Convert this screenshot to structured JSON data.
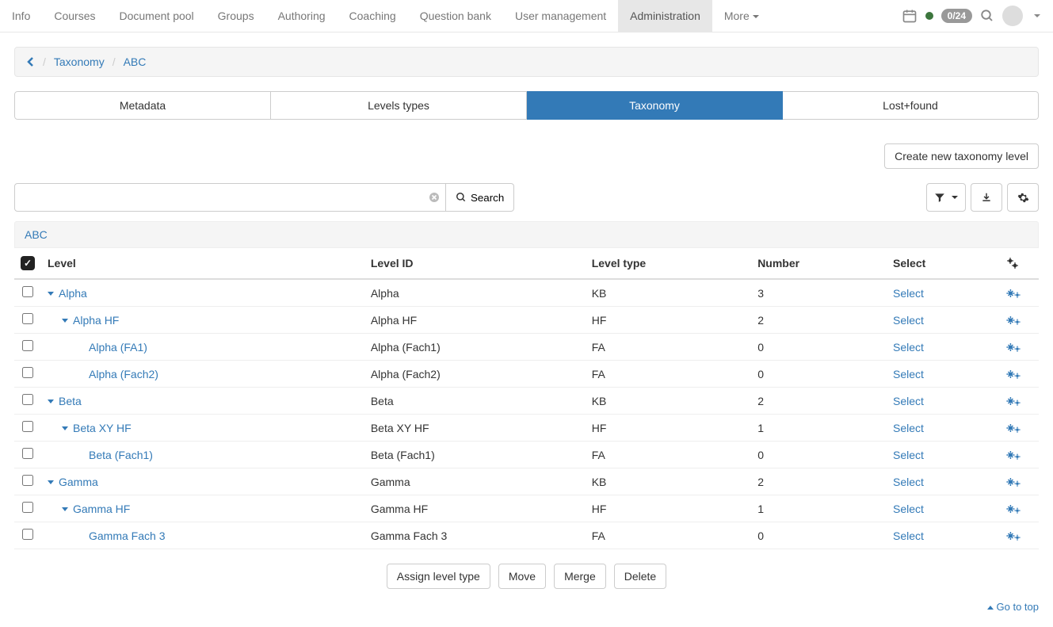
{
  "topnav": {
    "items": [
      "Info",
      "Courses",
      "Document pool",
      "Groups",
      "Authoring",
      "Coaching",
      "Question bank",
      "User management",
      "Administration",
      "More"
    ],
    "active_index": 8,
    "badge": "0/24"
  },
  "breadcrumb": {
    "items": [
      "Taxonomy",
      "ABC"
    ]
  },
  "tabs": {
    "items": [
      "Metadata",
      "Levels types",
      "Taxonomy",
      "Lost+found"
    ],
    "active_index": 2
  },
  "buttons": {
    "create": "Create new taxonomy level",
    "search": "Search",
    "assign": "Assign level type",
    "move": "Move",
    "merge": "Merge",
    "delete": "Delete",
    "gototop": "Go to top"
  },
  "pathbar": {
    "root": "ABC"
  },
  "table": {
    "headers": {
      "level": "Level",
      "level_id": "Level ID",
      "level_type": "Level type",
      "number": "Number",
      "select": "Select"
    },
    "select_label": "Select",
    "rows": [
      {
        "indent": 0,
        "caret": true,
        "level": "Alpha",
        "level_id": "Alpha",
        "level_type": "KB",
        "number": "3"
      },
      {
        "indent": 1,
        "caret": true,
        "level": "Alpha HF",
        "level_id": "Alpha HF",
        "level_type": "HF",
        "number": "2"
      },
      {
        "indent": 2,
        "caret": false,
        "level": "Alpha (FA1)",
        "level_id": "Alpha (Fach1)",
        "level_type": "FA",
        "number": "0"
      },
      {
        "indent": 2,
        "caret": false,
        "level": "Alpha (Fach2)",
        "level_id": "Alpha (Fach2)",
        "level_type": "FA",
        "number": "0"
      },
      {
        "indent": 0,
        "caret": true,
        "level": "Beta",
        "level_id": "Beta",
        "level_type": "KB",
        "number": "2"
      },
      {
        "indent": 1,
        "caret": true,
        "level": "Beta XY HF",
        "level_id": "Beta XY HF",
        "level_type": "HF",
        "number": "1"
      },
      {
        "indent": 2,
        "caret": false,
        "level": "Beta (Fach1)",
        "level_id": "Beta (Fach1)",
        "level_type": "FA",
        "number": "0"
      },
      {
        "indent": 0,
        "caret": true,
        "level": "Gamma",
        "level_id": "Gamma",
        "level_type": "KB",
        "number": "2"
      },
      {
        "indent": 1,
        "caret": true,
        "level": "Gamma HF",
        "level_id": "Gamma HF",
        "level_type": "HF",
        "number": "1"
      },
      {
        "indent": 2,
        "caret": false,
        "level": "Gamma Fach 3",
        "level_id": "Gamma Fach 3",
        "level_type": "FA",
        "number": "0"
      }
    ]
  }
}
